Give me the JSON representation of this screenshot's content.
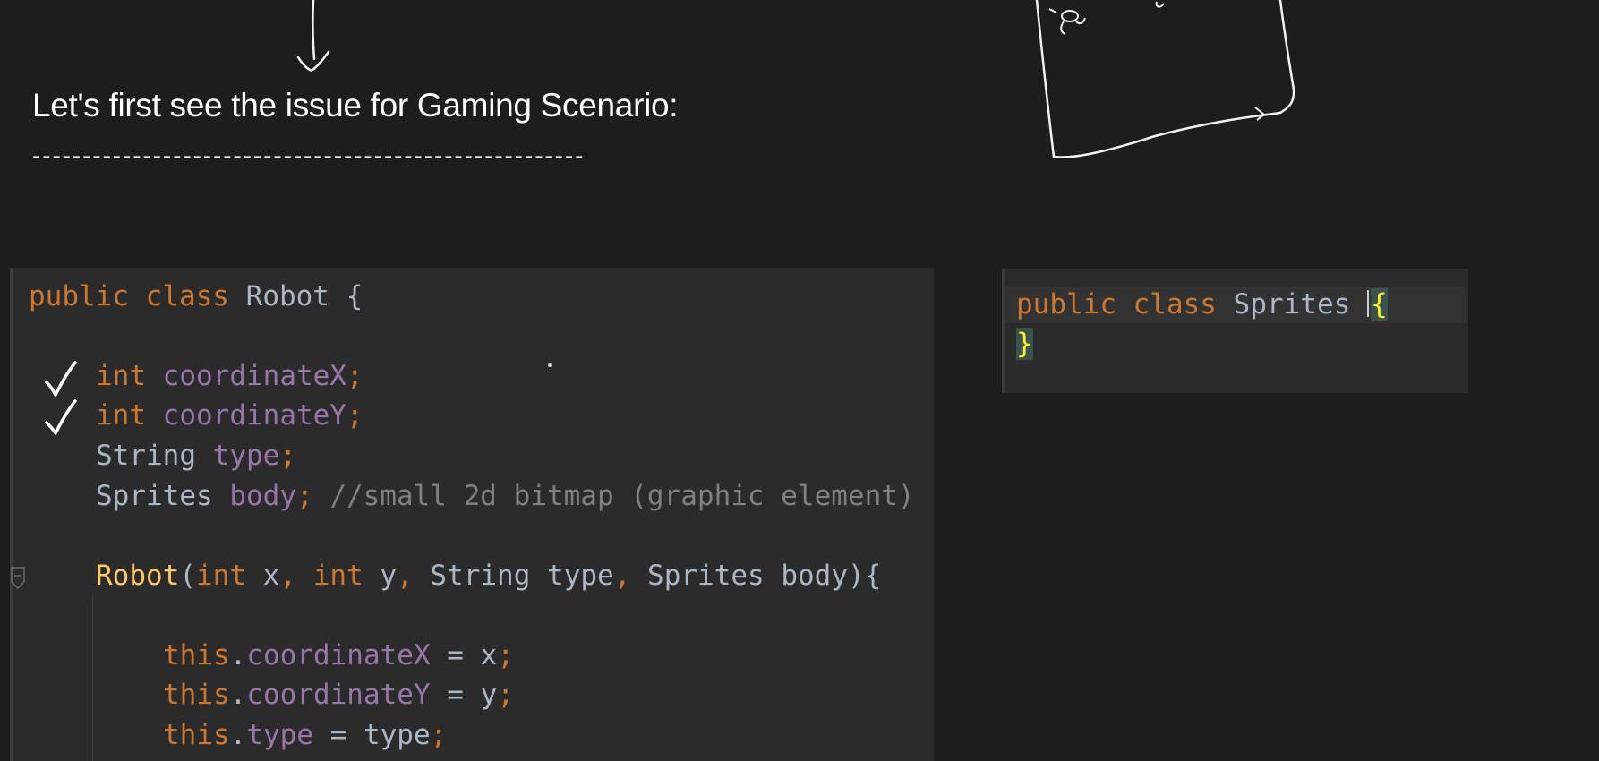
{
  "notes": {
    "heading": "Let's first see the issue for Gaming Scenario:",
    "divider": "-------------------------------------------------------"
  },
  "left_editor": {
    "line1": {
      "kw1": "public",
      "kw2": "class",
      "name": "Robot",
      "brace": "{"
    },
    "line2": {
      "type": "int",
      "field": "coordinateX",
      "semi": ";"
    },
    "line3": {
      "type": "int",
      "field": "coordinateY",
      "semi": ";"
    },
    "line4": {
      "type": "String",
      "field": "type",
      "semi": ";"
    },
    "line5": {
      "type": "Sprites",
      "field": "body",
      "semi": ";",
      "comment": "//small 2d bitmap (graphic element)"
    },
    "line6": {
      "name": "Robot",
      "open": "(",
      "t1": "int",
      "p1": "x",
      "c1": ",",
      "t2": "int",
      "p2": "y",
      "c2": ",",
      "t3": "String",
      "p3": "type",
      "c3": ",",
      "t4": "Sprites",
      "p4": "body",
      "close": "){"
    },
    "line7": {
      "this": "this",
      "dot": ".",
      "field": "coordinateX",
      "eq": " = ",
      "val": "x",
      "semi": ";"
    },
    "line8": {
      "this": "this",
      "dot": ".",
      "field": "coordinateY",
      "eq": " = ",
      "val": "y",
      "semi": ";"
    },
    "line9": {
      "this": "this",
      "dot": ".",
      "field": "type",
      "eq": " = ",
      "val": "type",
      "semi": ";"
    }
  },
  "right_editor": {
    "line1": {
      "kw1": "public",
      "kw2": "class",
      "name": "Sprites",
      "brace": "{"
    },
    "line2": {
      "brace": "}"
    }
  },
  "annotations": {
    "checkmarks": 2
  },
  "colors": {
    "background": "#1d1d1d",
    "editor_bg": "#2b2b2b",
    "keyword": "#cc7832",
    "field": "#9876aa",
    "identifier": "#a9b7c6",
    "method": "#ffc66d",
    "comment": "#808080",
    "brace_highlight": "#ffef28"
  }
}
